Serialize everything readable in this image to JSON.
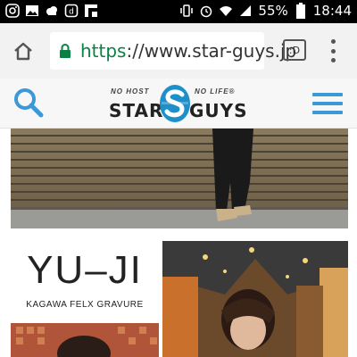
{
  "status_bar": {
    "icons_left": [
      "instagram-icon",
      "image-icon",
      "cloud-icon",
      "photo-icon",
      "flipboard-icon"
    ],
    "icons_right": [
      "vibrate-icon",
      "alarm-icon",
      "wifi-icon",
      "signal-icon"
    ],
    "battery": "55%",
    "time": "18:44"
  },
  "browser": {
    "url_scheme": "https",
    "url_rest": "://www.star-guys.jp",
    "tab_label": ":D"
  },
  "site": {
    "logo": {
      "tag_left": "NO HOST",
      "tag_right": "NO LIFE®",
      "word_left": "STAR",
      "word_right": "GUYS",
      "accent": "#1f8fc9"
    },
    "accent_color": "#3c98d6"
  },
  "content": {
    "card": {
      "title": "YU–JI",
      "subtitle": "KAGAWA FELX GRAVURE"
    }
  }
}
